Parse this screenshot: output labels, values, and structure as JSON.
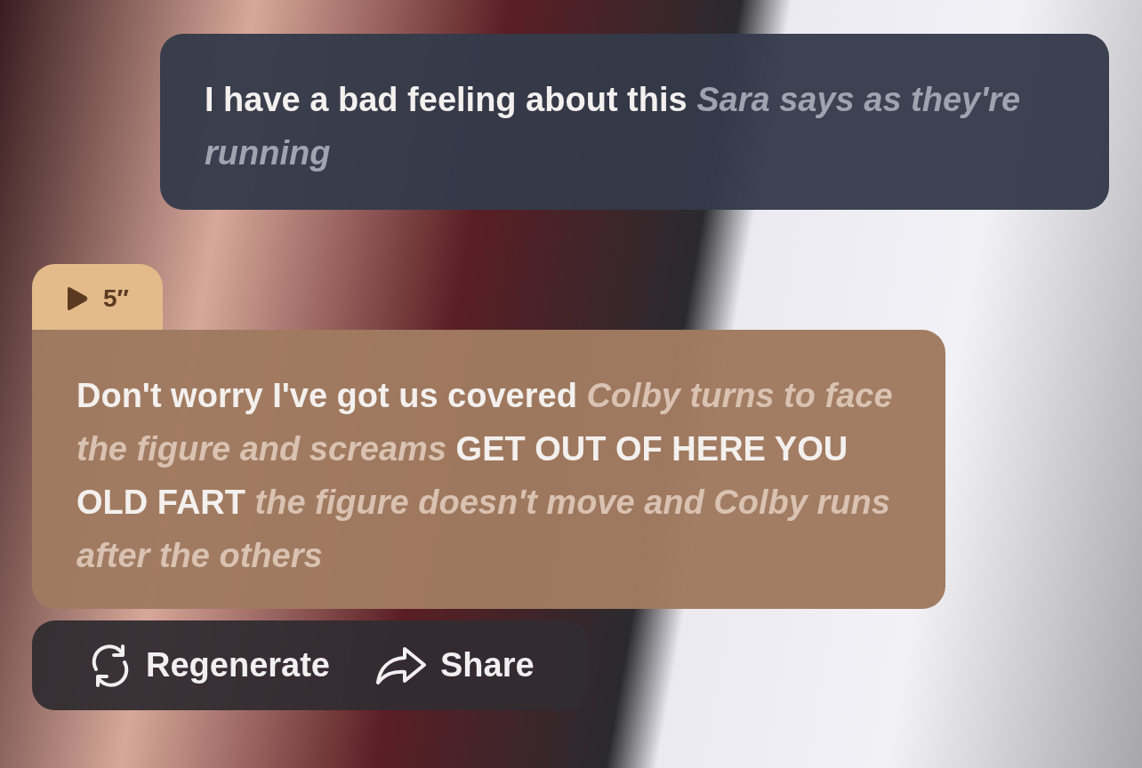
{
  "messages": [
    {
      "kind": "user",
      "text": "I have a bad feeling about this *Sara says as they're running*"
    },
    {
      "kind": "ai",
      "audio": {
        "duration": "5″"
      },
      "text": "Don't worry I've got us covered *Colby turns to face the figure and screams* GET OUT OF HERE YOU OLD FART *the figure doesn't move and Colby runs after the others*"
    }
  ],
  "actions": [
    {
      "kind": "regenerate",
      "label": "Regenerate"
    },
    {
      "kind": "share",
      "label": "Share"
    }
  ]
}
